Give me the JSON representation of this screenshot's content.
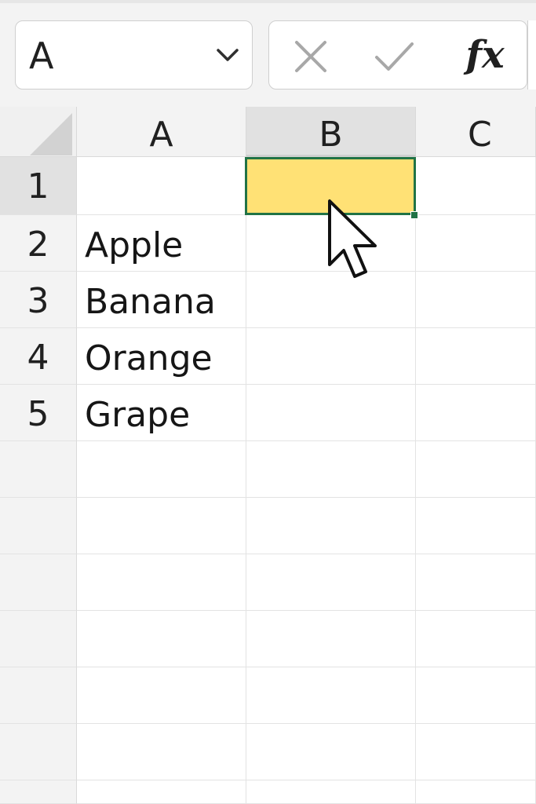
{
  "formula_bar": {
    "name_box_value": "A",
    "name_box_dropdown_icon": "chevron-down-icon",
    "cancel_icon": "close-icon",
    "enter_icon": "checkmark-icon",
    "function_label": "fx"
  },
  "sheet": {
    "columns": [
      "A",
      "B",
      "C"
    ],
    "rows": [
      "1",
      "2",
      "3",
      "4",
      "5"
    ],
    "cells": {
      "A2": "Apple",
      "A3": "Banana",
      "A4": "Orange",
      "A5": "Grape"
    },
    "selected_cell": "B1",
    "selected_fill_color": "#ffe175",
    "selection_border_color": "#217346"
  },
  "cursor_icon": "mouse-pointer-icon"
}
